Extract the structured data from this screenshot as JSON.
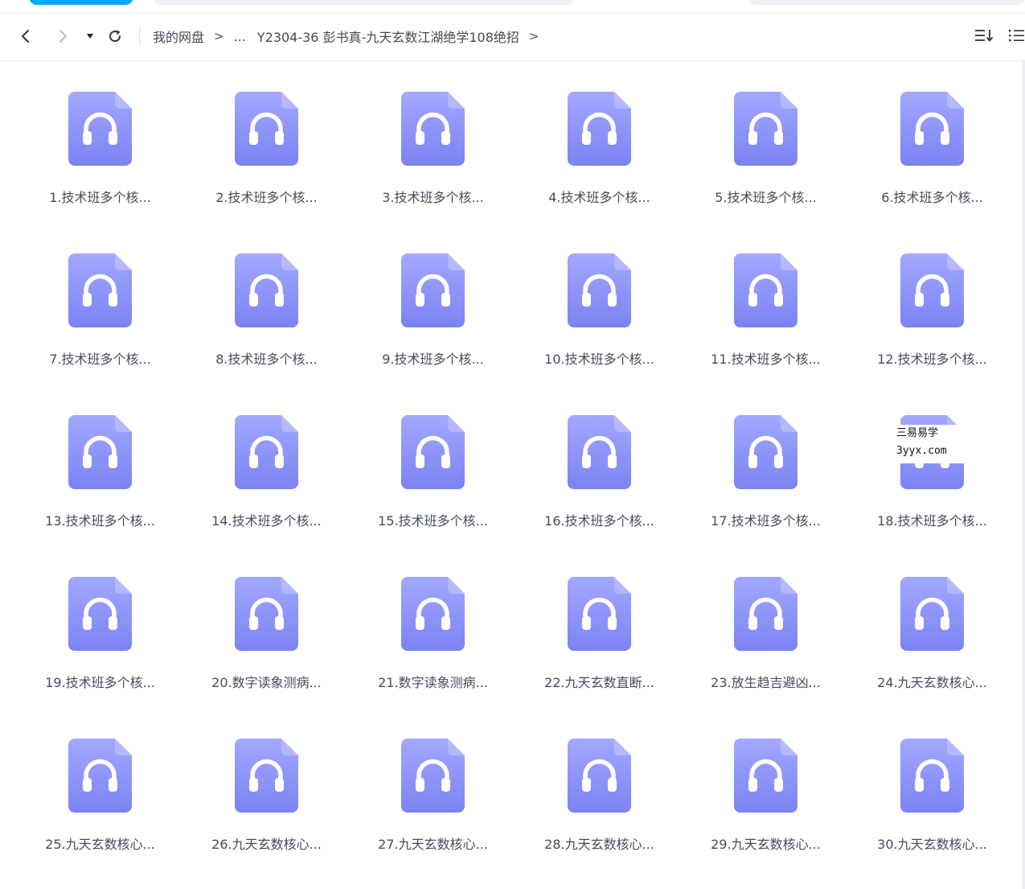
{
  "breadcrumb": {
    "root": "我的网盘",
    "ellipsis": "...",
    "current": "Y2304-36 彭书真-九天玄数江湖绝学108绝招",
    "separator": ">"
  },
  "colors": {
    "file_icon_top": "#a3a8ff",
    "file_icon_bottom": "#7b83f2",
    "icon_glyph": "#ffffff",
    "text": "#454d5a"
  },
  "icons": {
    "back": "chevron-left-icon",
    "forward": "chevron-right-icon",
    "history": "caret-down-icon",
    "refresh": "refresh-icon",
    "sort": "sort-icon",
    "list_view": "list-view-icon",
    "file": "audio-file-icon"
  },
  "files": [
    {
      "name": "1.技术班多个核..."
    },
    {
      "name": "2.技术班多个核..."
    },
    {
      "name": "3.技术班多个核..."
    },
    {
      "name": "4.技术班多个核..."
    },
    {
      "name": "5.技术班多个核..."
    },
    {
      "name": "6.技术班多个核..."
    },
    {
      "name": "7.技术班多个核..."
    },
    {
      "name": "8.技术班多个核..."
    },
    {
      "name": "9.技术班多个核..."
    },
    {
      "name": "10.技术班多个核..."
    },
    {
      "name": "11.技术班多个核..."
    },
    {
      "name": "12.技术班多个核..."
    },
    {
      "name": "13.技术班多个核..."
    },
    {
      "name": "14.技术班多个核..."
    },
    {
      "name": "15.技术班多个核..."
    },
    {
      "name": "16.技术班多个核..."
    },
    {
      "name": "17.技术班多个核..."
    },
    {
      "name": "18.技术班多个核..."
    },
    {
      "name": "19.技术班多个核..."
    },
    {
      "name": "20.数字读象测病..."
    },
    {
      "name": "21.数字读象测病..."
    },
    {
      "name": "22.九天玄数直断..."
    },
    {
      "name": "23.放生趋吉避凶..."
    },
    {
      "name": "24.九天玄数核心..."
    },
    {
      "name": "25.九天玄数核心..."
    },
    {
      "name": "26.九天玄数核心..."
    },
    {
      "name": "27.九天玄数核心..."
    },
    {
      "name": "28.九天玄数核心..."
    },
    {
      "name": "29.九天玄数核心..."
    },
    {
      "name": "30.九天玄数核心..."
    }
  ],
  "watermark": {
    "line1": "三易易学",
    "line2": "3yyx.com"
  }
}
